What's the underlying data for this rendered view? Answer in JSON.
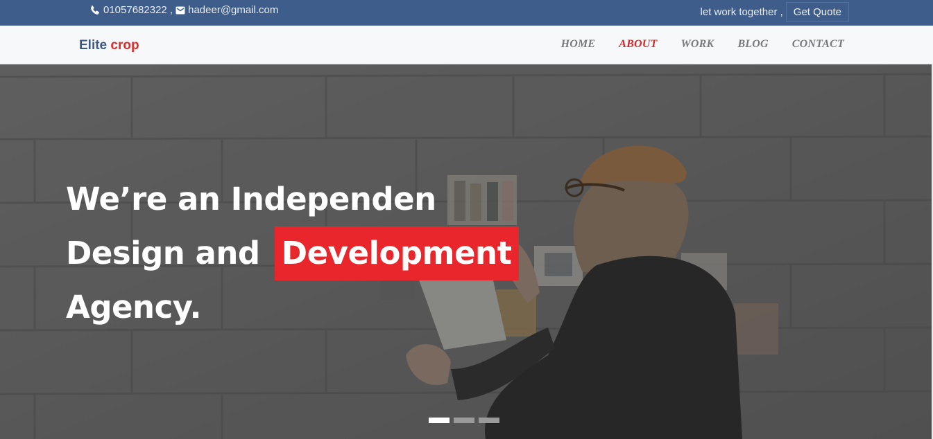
{
  "topbar": {
    "phone": "01057682322 ,",
    "email": "hadeer@gmail.com",
    "tagline": "let work together ,",
    "quote_button": "Get Quote",
    "icons": {
      "phone": "phone-icon",
      "email": "envelope-icon"
    }
  },
  "brand": {
    "part1": "Elite",
    "part2": "crop"
  },
  "nav": {
    "items": [
      {
        "label": "HOME"
      },
      {
        "label": "ABOUT",
        "active": true
      },
      {
        "label": "WORK"
      },
      {
        "label": "BLOG"
      },
      {
        "label": "CONTACT"
      }
    ]
  },
  "hero": {
    "line1": "We’re an Independen",
    "line2_prefix": "Design and",
    "line2_highlight": "Development",
    "line3": "Agency.",
    "slides": {
      "count": 3,
      "active_index": 0
    }
  },
  "colors": {
    "topbar_bg": "#3f5d8a",
    "accent_red": "#e8262b",
    "brand_blue": "#3d5a86",
    "nav_text": "#77797c",
    "nav_active": "#d42a2a"
  }
}
